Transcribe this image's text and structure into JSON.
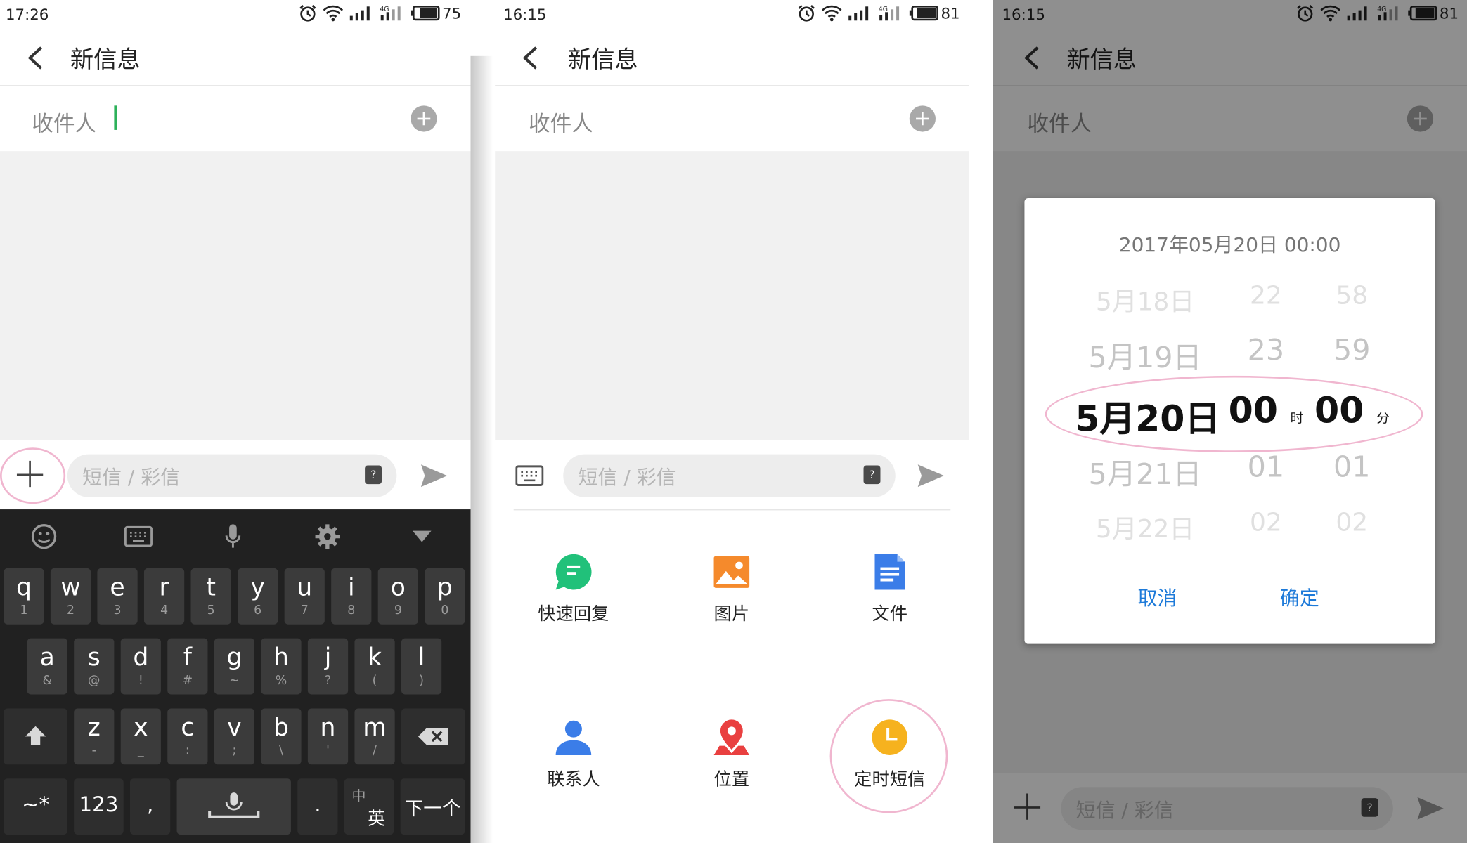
{
  "panels": [
    {
      "status": {
        "time": "17:26",
        "battery": "75"
      },
      "header": {
        "title": "新信息"
      },
      "recipient": {
        "label": "收件人"
      },
      "compose": {
        "placeholder": "短信 / 彩信",
        "mms_badge": "?"
      },
      "keyboard": {
        "row1": [
          {
            "main": "q",
            "sub": "1"
          },
          {
            "main": "w",
            "sub": "2"
          },
          {
            "main": "e",
            "sub": "3"
          },
          {
            "main": "r",
            "sub": "4"
          },
          {
            "main": "t",
            "sub": "5"
          },
          {
            "main": "y",
            "sub": "6"
          },
          {
            "main": "u",
            "sub": "7"
          },
          {
            "main": "i",
            "sub": "8"
          },
          {
            "main": "o",
            "sub": "9"
          },
          {
            "main": "p",
            "sub": "0"
          }
        ],
        "row2": [
          {
            "main": "a",
            "sub": "&"
          },
          {
            "main": "s",
            "sub": "@"
          },
          {
            "main": "d",
            "sub": "!"
          },
          {
            "main": "f",
            "sub": "#"
          },
          {
            "main": "g",
            "sub": "~"
          },
          {
            "main": "h",
            "sub": "%"
          },
          {
            "main": "j",
            "sub": "?"
          },
          {
            "main": "k",
            "sub": "("
          },
          {
            "main": "l",
            "sub": ")"
          }
        ],
        "row3": [
          {
            "main": "z",
            "sub": "-"
          },
          {
            "main": "x",
            "sub": "_"
          },
          {
            "main": "c",
            "sub": ":"
          },
          {
            "main": "v",
            "sub": ";"
          },
          {
            "main": "b",
            "sub": "\\"
          },
          {
            "main": "n",
            "sub": "'"
          },
          {
            "main": "m",
            "sub": "/"
          }
        ],
        "sym_key": "~*",
        "num_key": "123",
        "comma_key": ",",
        "period_key": ".",
        "lang_key_top": "中",
        "lang_key_bottom": "英",
        "next_key": "下一个"
      }
    },
    {
      "status": {
        "time": "16:15",
        "battery": "81"
      },
      "header": {
        "title": "新信息"
      },
      "recipient": {
        "label": "收件人"
      },
      "compose": {
        "placeholder": "短信 / 彩信",
        "mms_badge": "?"
      },
      "attachments": [
        {
          "label": "快速回复",
          "icon": "quick-reply-icon",
          "color": "#21c17a"
        },
        {
          "label": "图片",
          "icon": "image-icon",
          "color": "#f58a2c"
        },
        {
          "label": "文件",
          "icon": "file-icon",
          "color": "#3b7de8"
        },
        {
          "label": "联系人",
          "icon": "contact-icon",
          "color": "#3b7de8"
        },
        {
          "label": "位置",
          "icon": "location-icon",
          "color": "#e94040"
        },
        {
          "label": "定时短信",
          "icon": "clock-icon",
          "color": "#f6b21e"
        }
      ]
    },
    {
      "status": {
        "time": "16:15",
        "battery": "81"
      },
      "header": {
        "title": "新信息"
      },
      "recipient": {
        "label": "收件人"
      },
      "compose": {
        "placeholder": "短信 / 彩信",
        "mms_badge": "?"
      },
      "dialog": {
        "datetime": "2017年05月20日  00:00",
        "dates": [
          "5月18日",
          "5月19日",
          "5月20日",
          "5月21日",
          "5月22日"
        ],
        "hours": [
          "22",
          "23",
          "00",
          "01",
          "02"
        ],
        "minutes": [
          "58",
          "59",
          "00",
          "01",
          "02"
        ],
        "hour_unit": "时",
        "minute_unit": "分",
        "cancel": "取消",
        "confirm": "确定"
      }
    }
  ]
}
